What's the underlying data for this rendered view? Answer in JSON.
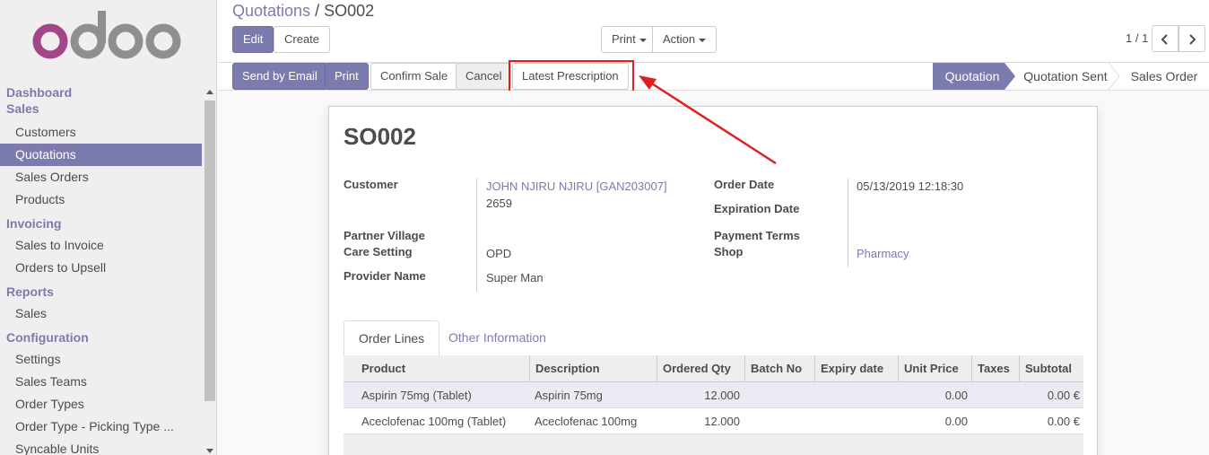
{
  "app": {
    "logo_text": "odoo"
  },
  "sidebar": {
    "sections": [
      {
        "title": "Dashboard",
        "items": []
      },
      {
        "title": "Sales",
        "items": [
          "Customers",
          "Quotations",
          "Sales Orders",
          "Products"
        ]
      },
      {
        "title": "Invoicing",
        "items": [
          "Sales to Invoice",
          "Orders to Upsell"
        ]
      },
      {
        "title": "Reports",
        "items": [
          "Sales"
        ]
      },
      {
        "title": "Configuration",
        "items": [
          "Settings",
          "Sales Teams",
          "Order Types",
          "Order Type - Picking Type ...",
          "Syncable Units"
        ]
      }
    ],
    "active_item": "Quotations"
  },
  "breadcrumb": {
    "parent": "Quotations",
    "separator": "/",
    "current": "SO002"
  },
  "toolbar": {
    "edit_label": "Edit",
    "create_label": "Create",
    "print_label": "Print",
    "action_label": "Action",
    "pager_value": "1 / 1",
    "prev_icon": "chevron-left-icon",
    "next_icon": "chevron-right-icon"
  },
  "statusbar": {
    "buttons": {
      "send_email": "Send by Email",
      "print": "Print",
      "confirm_sale": "Confirm Sale",
      "cancel": "Cancel",
      "latest_prescription": "Latest Prescription"
    },
    "stages": [
      "Quotation",
      "Quotation Sent",
      "Sales Order"
    ],
    "active_stage": "Quotation"
  },
  "form": {
    "title": "SO002",
    "left": {
      "customer_label": "Customer",
      "customer_value": "JOHN NJIRU NJIRU [GAN203007]",
      "customer_sub": "2659",
      "partner_village_label": "Partner Village",
      "care_setting_label": "Care Setting",
      "care_setting_value": "OPD",
      "provider_label": "Provider Name",
      "provider_value": "Super Man"
    },
    "right": {
      "order_date_label": "Order Date",
      "order_date_value": "05/13/2019 12:18:30",
      "expiration_label": "Expiration Date",
      "payment_terms_label": "Payment Terms",
      "shop_label": "Shop",
      "shop_value": "Pharmacy"
    },
    "tabs": [
      "Order Lines",
      "Other Information"
    ],
    "table": {
      "headers": [
        "Product",
        "Description",
        "Ordered Qty",
        "Batch No",
        "Expiry date",
        "Unit Price",
        "Taxes",
        "Subtotal"
      ],
      "rows": [
        [
          "Aspirin 75mg (Tablet)",
          "Aspirin 75mg",
          "12.000",
          "",
          "",
          "0.00",
          "",
          "0.00 €"
        ],
        [
          "Aceclofenac 100mg (Tablet)",
          "Aceclofenac 100mg",
          "12.000",
          "",
          "",
          "0.00",
          "",
          "0.00 €"
        ]
      ]
    }
  },
  "colors": {
    "brand": "#7c7bad",
    "annotation": "#e02020"
  }
}
